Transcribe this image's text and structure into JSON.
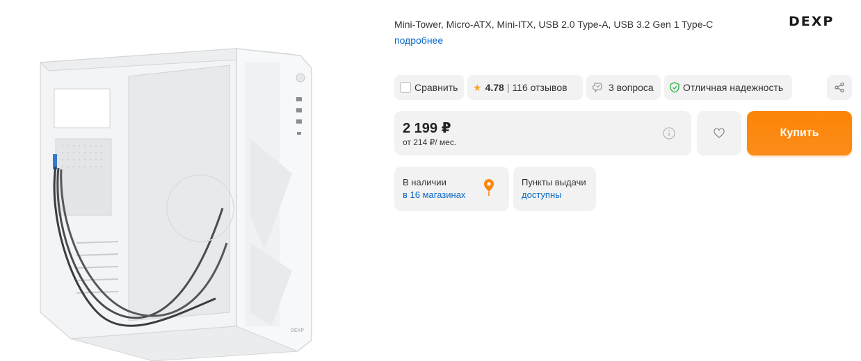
{
  "product": {
    "specs": "Mini-Tower, Micro-ATX, Mini-ITX, USB 2.0 Type-A, USB 3.2 Gen 1 Type-C",
    "more_link": "подробнее",
    "brand": "DEXP",
    "image_icon": "pc-case-image",
    "image_logo": "DEXP"
  },
  "actions": {
    "compare_label": "Сравнить",
    "rating": "4.78",
    "reviews": "116 отзывов",
    "questions": "3 вопроса",
    "reliability": "Отличная надежность",
    "share_icon": "share-icon"
  },
  "price": {
    "value": "2 199 ₽",
    "monthly": "от 214 ₽/ мес.",
    "info_icon": "info-icon"
  },
  "buttons": {
    "favorite_icon": "heart-icon",
    "buy_label": "Купить"
  },
  "availability": {
    "stores_title": "В наличии",
    "stores_link": "в 16 магазинах",
    "pickup_title": "Пункты выдачи",
    "pickup_link": "доступны"
  },
  "colors": {
    "accent": "#fc8507",
    "link": "#0a69c7",
    "chip_bg": "#f2f2f2",
    "star": "#f5a623",
    "shield": "#2fb84b"
  }
}
